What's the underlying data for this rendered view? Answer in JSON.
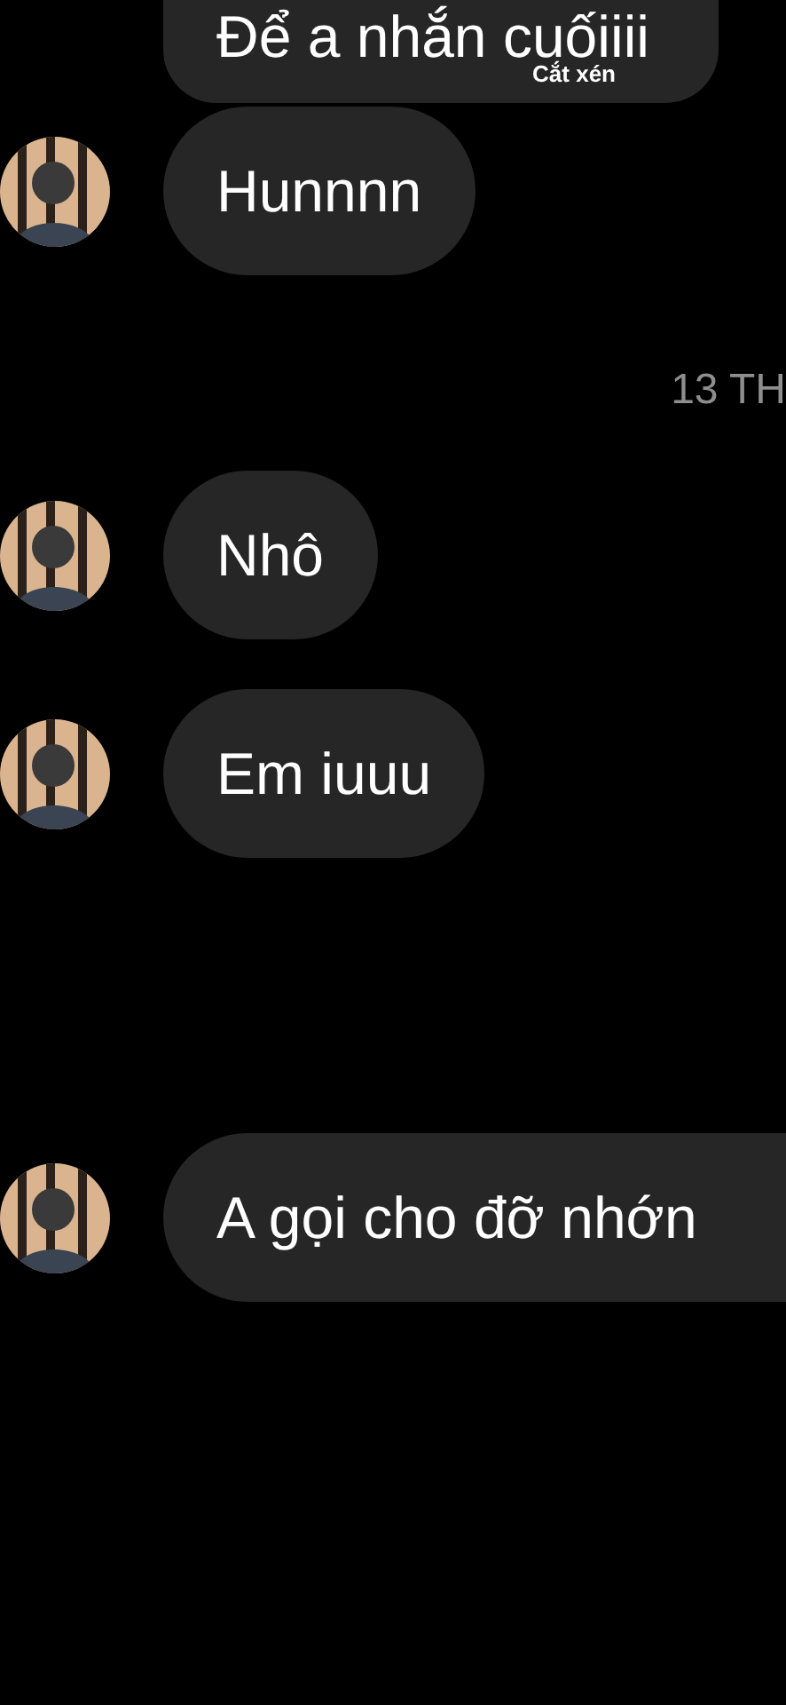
{
  "items": [
    {
      "kind": "message",
      "text": "Để a nhắn cuốiiii",
      "overlay_label": "Cắt xén",
      "avatar": false,
      "cut": false
    },
    {
      "kind": "message",
      "text": "Hunnnn",
      "avatar": true,
      "cut": false
    },
    {
      "kind": "timestamp",
      "text": "13 TH"
    },
    {
      "kind": "message",
      "text": "Nhô",
      "avatar": true,
      "cut": false
    },
    {
      "kind": "message",
      "text": "Em iuuu",
      "avatar": true,
      "cut": false
    },
    {
      "kind": "message",
      "text": "A gọi cho đỡ nhớn",
      "avatar": true,
      "cut": true
    }
  ]
}
